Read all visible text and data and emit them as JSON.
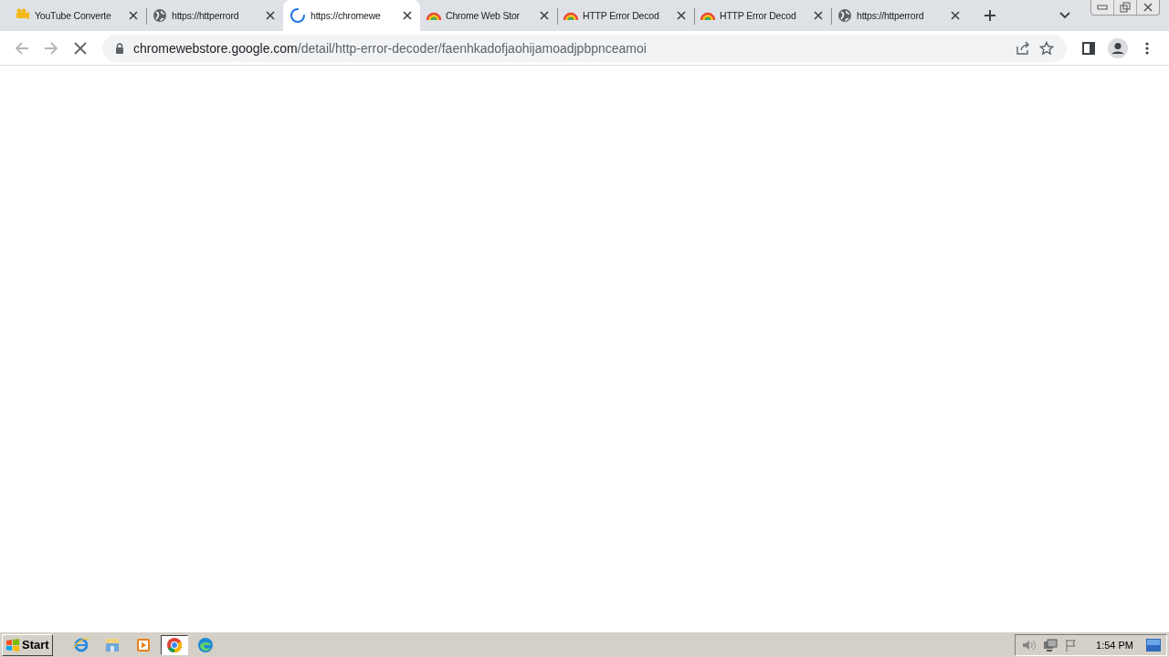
{
  "tabs": [
    {
      "title": "YouTube Converte",
      "kind": "app",
      "selected": false
    },
    {
      "title": "https://httperrord",
      "kind": "globe",
      "selected": false
    },
    {
      "title": "https://chromewe",
      "kind": "loading",
      "selected": true
    },
    {
      "title": "Chrome Web Stor",
      "kind": "store",
      "selected": false
    },
    {
      "title": "HTTP Error Decod",
      "kind": "store",
      "selected": false
    },
    {
      "title": "HTTP Error Decod",
      "kind": "store",
      "selected": false
    },
    {
      "title": "https://httperrord",
      "kind": "globe",
      "selected": false
    }
  ],
  "toolbar": {
    "back_disabled": true,
    "forward_disabled": true,
    "loading": true,
    "url": {
      "host": "chromewebstore.google.com",
      "path": "/detail/http-error-decoder/faenhkadofjaohijamoadjpbpnceamoi"
    }
  },
  "taskbar": {
    "start": "Start",
    "apps": [
      {
        "kind": "ie",
        "selected": false
      },
      {
        "kind": "folder",
        "selected": false
      },
      {
        "kind": "media",
        "selected": false
      },
      {
        "kind": "chrome",
        "selected": true
      },
      {
        "kind": "edge",
        "selected": false
      }
    ],
    "clock": "1:54 PM"
  }
}
